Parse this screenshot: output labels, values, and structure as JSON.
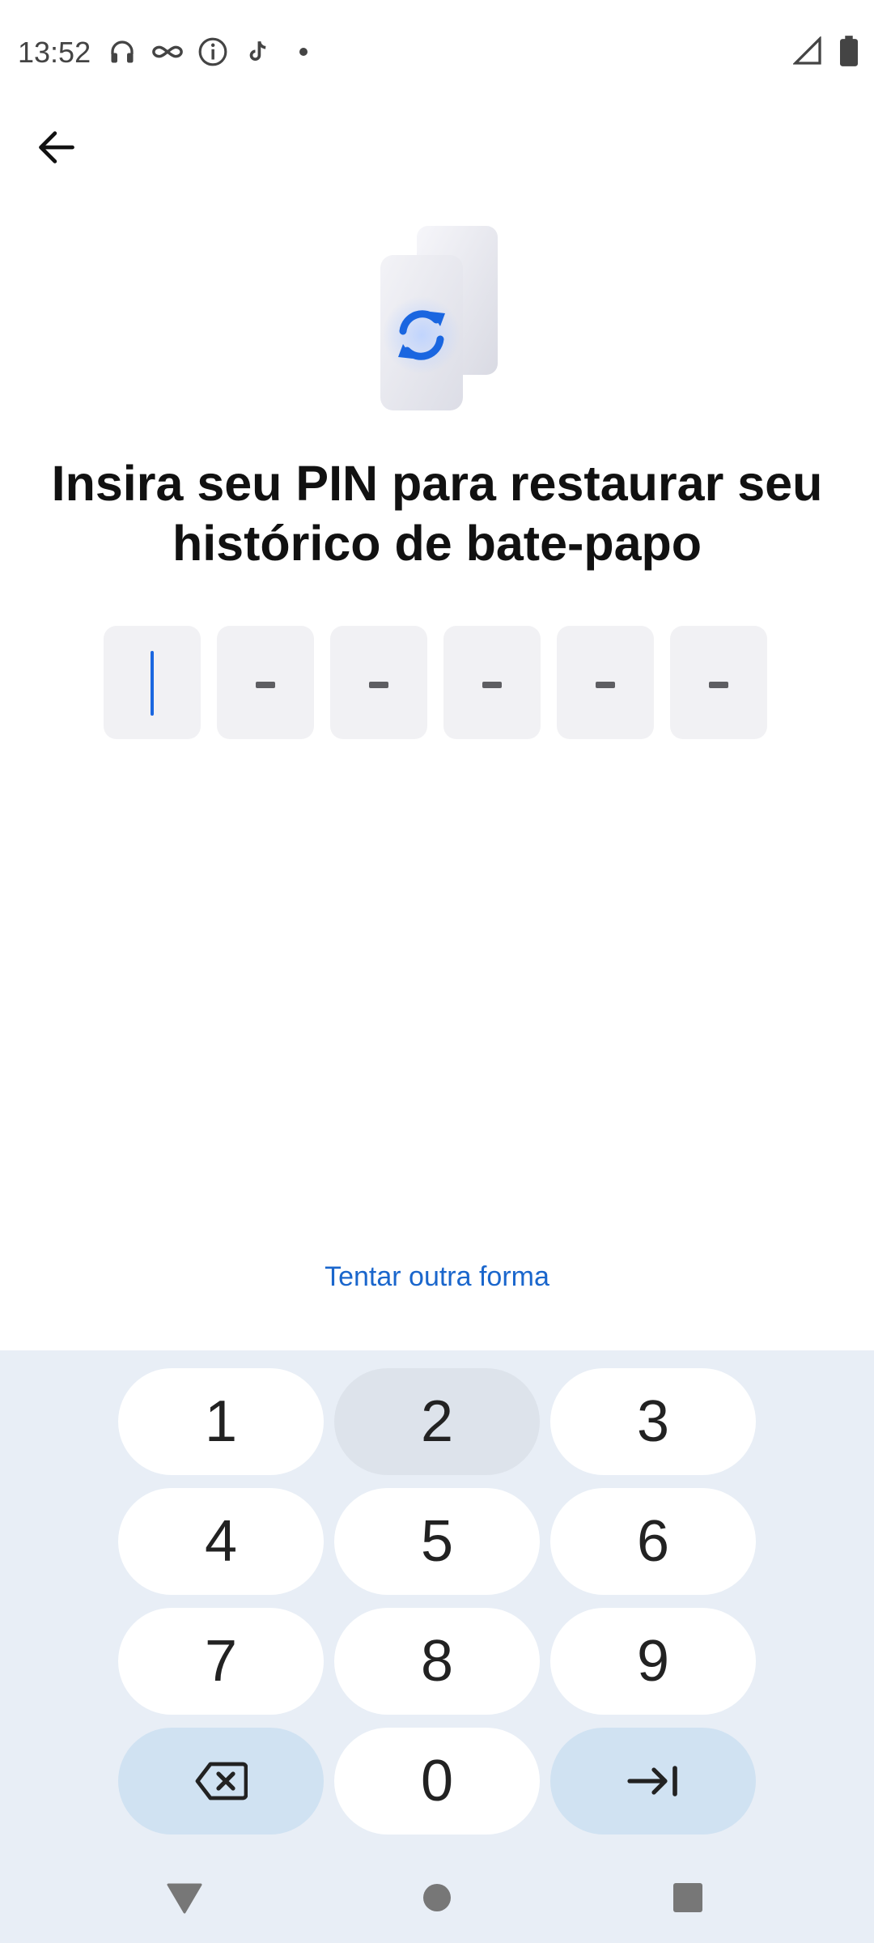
{
  "status": {
    "time": "13:52",
    "left_icons": [
      "headphones-icon",
      "infinity-icon",
      "info-icon",
      "tiktok-icon",
      "dot-icon"
    ],
    "right_icons": [
      "signal-icon",
      "battery-icon"
    ]
  },
  "header": {
    "back_icon": "arrow-left-icon"
  },
  "illustration": {
    "icon": "sync-phones-icon",
    "accent": "#1a66e0"
  },
  "title": "Insira seu PIN para restaurar seu histórico de bate-papo",
  "pin": {
    "length": 6,
    "filled": 0,
    "placeholder": "-"
  },
  "try_another": "Tentar outra forma",
  "keypad": {
    "keys": [
      "1",
      "2",
      "3",
      "4",
      "5",
      "6",
      "7",
      "8",
      "9",
      "",
      "0",
      ""
    ],
    "pressed": "2",
    "backspace_icon": "backspace-icon",
    "next_icon": "tab-next-icon"
  },
  "colors": {
    "link": "#1a66cc",
    "keypad_bg": "#e8eef6",
    "action_key": "#d0e2f2"
  },
  "navigation": [
    "back-triangle-icon",
    "home-circle-icon",
    "recents-square-icon"
  ]
}
